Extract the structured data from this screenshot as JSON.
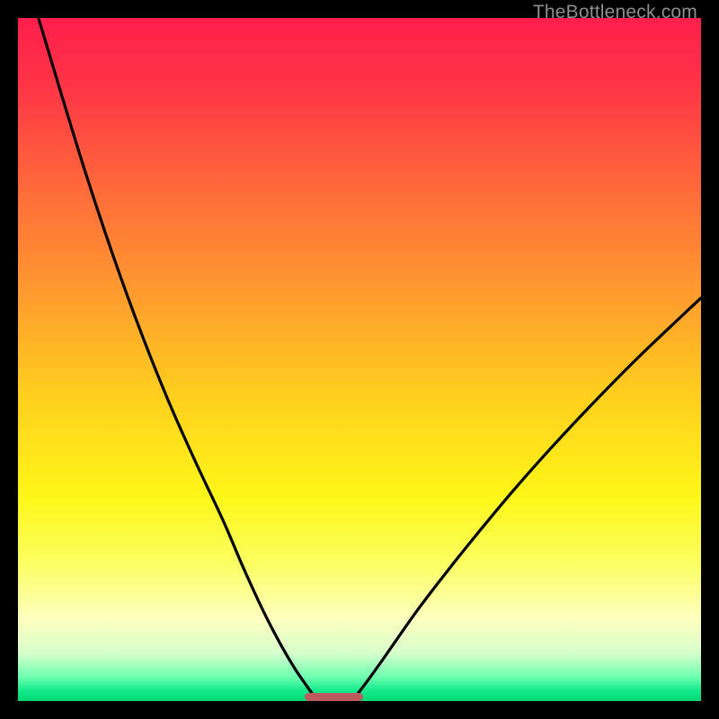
{
  "watermark": "TheBottleneck.com",
  "chart_data": {
    "type": "line",
    "title": "",
    "xlabel": "",
    "ylabel": "",
    "xlim": [
      0,
      100
    ],
    "ylim": [
      0,
      100
    ],
    "background_gradient": {
      "stops": [
        {
          "offset": 0.0,
          "color": "#ff1f4b"
        },
        {
          "offset": 0.1,
          "color": "#ff3547"
        },
        {
          "offset": 0.25,
          "color": "#ff6a3a"
        },
        {
          "offset": 0.4,
          "color": "#ff9a2f"
        },
        {
          "offset": 0.55,
          "color": "#ffce1e"
        },
        {
          "offset": 0.7,
          "color": "#fff618"
        },
        {
          "offset": 0.8,
          "color": "#fbff63"
        },
        {
          "offset": 0.88,
          "color": "#feffbf"
        },
        {
          "offset": 0.93,
          "color": "#d6ffcb"
        },
        {
          "offset": 0.965,
          "color": "#6dffb0"
        },
        {
          "offset": 0.985,
          "color": "#13e989"
        },
        {
          "offset": 1.0,
          "color": "#03d877"
        }
      ]
    },
    "series": [
      {
        "name": "left-curve",
        "x": [
          3.0,
          6.0,
          10.0,
          14.0,
          18.0,
          22.0,
          26.0,
          30.0,
          33.0,
          36.0,
          38.5,
          40.5,
          42.0,
          43.0,
          43.8
        ],
        "y": [
          100.0,
          90.0,
          77.0,
          65.0,
          54.0,
          44.0,
          35.0,
          26.5,
          19.5,
          13.0,
          8.2,
          4.8,
          2.6,
          1.2,
          0.2
        ]
      },
      {
        "name": "right-curve",
        "x": [
          49.0,
          50.0,
          51.5,
          53.5,
          56.0,
          59.0,
          63.0,
          67.5,
          72.5,
          78.0,
          84.0,
          90.5,
          97.0,
          100.0
        ],
        "y": [
          0.2,
          1.4,
          3.4,
          6.2,
          9.8,
          14.0,
          19.2,
          24.8,
          30.8,
          37.0,
          43.4,
          50.0,
          56.2,
          59.0
        ]
      }
    ],
    "marker": {
      "x_start": 42.0,
      "x_end": 50.5,
      "y": 0.5,
      "color": "#bc5a60"
    }
  }
}
